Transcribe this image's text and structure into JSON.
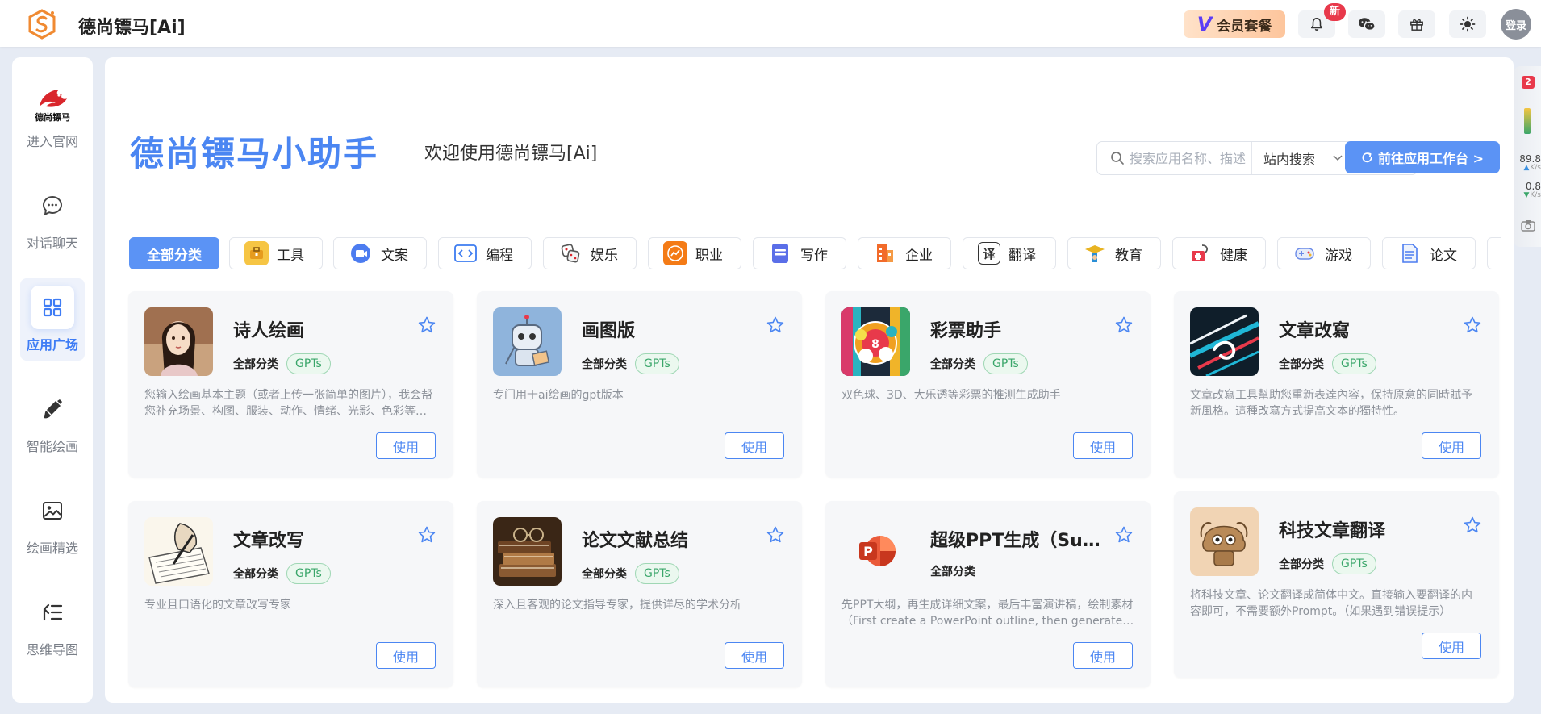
{
  "header": {
    "brand": "德尚镖马[Ai]",
    "vip_label": "会员套餐",
    "new_badge": "新",
    "login_label": "登录",
    "colors": {
      "accent": "#4b86f2",
      "vip_bg": "#fdc59c",
      "badge_red": "#e8394b"
    }
  },
  "sidebar": {
    "items": [
      {
        "label": "进入官网"
      },
      {
        "label": "对话聊天"
      },
      {
        "label": "应用广场"
      },
      {
        "label": "智能绘画"
      },
      {
        "label": "绘画精选"
      },
      {
        "label": "思维导图"
      }
    ],
    "logo_text": "德尚镖马",
    "active": "应用广场"
  },
  "hero": {
    "title": "德尚镖马小助手",
    "subtitle": "欢迎使用德尚镖马[Ai]"
  },
  "search": {
    "placeholder": "搜索应用名称、描述",
    "scope": "站内搜索",
    "goto_label": "前往应用工作台 >"
  },
  "categories": [
    {
      "label": "全部分类",
      "icon": "none"
    },
    {
      "label": "工具",
      "icon": "toolbox-icon"
    },
    {
      "label": "文案",
      "icon": "video-icon"
    },
    {
      "label": "编程",
      "icon": "code-icon"
    },
    {
      "label": "娱乐",
      "icon": "dice-icon"
    },
    {
      "label": "职业",
      "icon": "chart-icon"
    },
    {
      "label": "写作",
      "icon": "doc-icon"
    },
    {
      "label": "企业",
      "icon": "building-icon"
    },
    {
      "label": "翻译",
      "icon": "translate-icon"
    },
    {
      "label": "教育",
      "icon": "graduation-icon"
    },
    {
      "label": "健康",
      "icon": "health-icon"
    },
    {
      "label": "游戏",
      "icon": "game-icon"
    },
    {
      "label": "论文",
      "icon": "paper-icon"
    }
  ],
  "apps": [
    {
      "title": "诗人绘画",
      "category": "全部分类",
      "tag": "GPTs",
      "desc": "您输入绘画基本主题（或者上传一张简单的图片），我会帮您补充场景、构图、服装、动作、情绪、光影、色彩等细节",
      "use": "使用"
    },
    {
      "title": "画图版",
      "category": "全部分类",
      "tag": "GPTs",
      "desc": "专门用于ai绘画的gpt版本",
      "use": "使用"
    },
    {
      "title": "彩票助手",
      "category": "全部分类",
      "tag": "GPTs",
      "desc": "双色球、3D、大乐透等彩票的推测生成助手",
      "use": "使用"
    },
    {
      "title": "文章改寫",
      "category": "全部分类",
      "tag": "GPTs",
      "desc": "文章改寫工具幫助您重新表達內容，保持原意的同時賦予新風格。這種改寫方式提高文本的獨特性。",
      "use": "使用"
    },
    {
      "title": "文章改写",
      "category": "全部分类",
      "tag": "GPTs",
      "desc": "专业且口语化的文章改写专家",
      "use": "使用"
    },
    {
      "title": "论文文献总结",
      "category": "全部分类",
      "tag": "GPTs",
      "desc": "深入且客观的论文指导专家，提供详尽的学术分析",
      "use": "使用"
    },
    {
      "title": "超级PPT生成（SuperPPT）",
      "category": "全部分类",
      "tag": "",
      "desc": "先PPT大纲，再生成详细文案，最后丰富演讲稿，绘制素材（First create a PowerPoint outline, then generate detailed copy）",
      "use": "使用"
    },
    {
      "title": "科技文章翻译",
      "category": "全部分类",
      "tag": "GPTs",
      "desc": "将科技文章、论文翻译成简体中文。直接输入要翻译的内容即可，不需要额外Prompt。（如果遇到错误提示）",
      "use": "使用"
    }
  ],
  "widget": {
    "count": "2",
    "up_speed": "89.8",
    "up_unit": "K/s",
    "down_speed": "0.8",
    "down_unit": "K/s"
  }
}
